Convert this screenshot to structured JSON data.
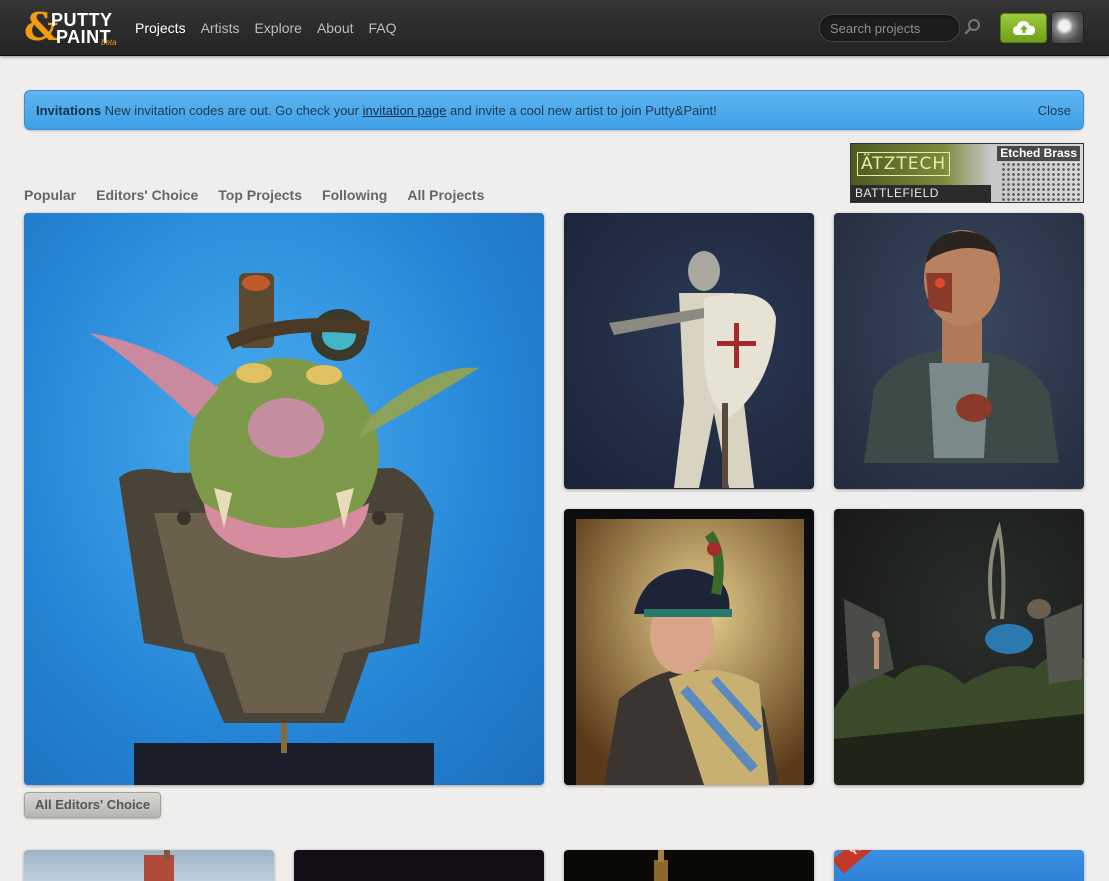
{
  "header": {
    "logo_top": "PUTTY",
    "logo_bottom": "PAINT",
    "logo_beta": "beta",
    "nav": [
      {
        "label": "Projects",
        "active": true
      },
      {
        "label": "Artists"
      },
      {
        "label": "Explore"
      },
      {
        "label": "About"
      },
      {
        "label": "FAQ"
      }
    ],
    "search_placeholder": "Search projects",
    "icons": {
      "search": "search-icon",
      "upload": "cloud-upload-icon",
      "avatar": "user-avatar"
    },
    "upload_color": "#8cbf2f"
  },
  "alert": {
    "title": "Invitations",
    "text_before": " New invitation codes are out. Go check your ",
    "link": "invitation page",
    "text_after": " and invite a cool new artist to join Putty&Paint!",
    "close": "Close",
    "color": "#4aa8ec"
  },
  "ad": {
    "brand": "ÄTZTECH",
    "tagline": "BATTLEFIELD SCENERY",
    "product": "Etched Brass"
  },
  "tabs": [
    "Popular",
    "Editors' Choice",
    "Top Projects",
    "Following",
    "All Projects"
  ],
  "grid": [
    {
      "name": "goblin-bust"
    },
    {
      "name": "crusader-knight"
    },
    {
      "name": "cyborg-bust"
    },
    {
      "name": "highlander-bust"
    },
    {
      "name": "fantasy-diorama"
    }
  ],
  "all_editors_choice": "All Editors' Choice",
  "bottom_row": {
    "ribbon": "YOU"
  }
}
